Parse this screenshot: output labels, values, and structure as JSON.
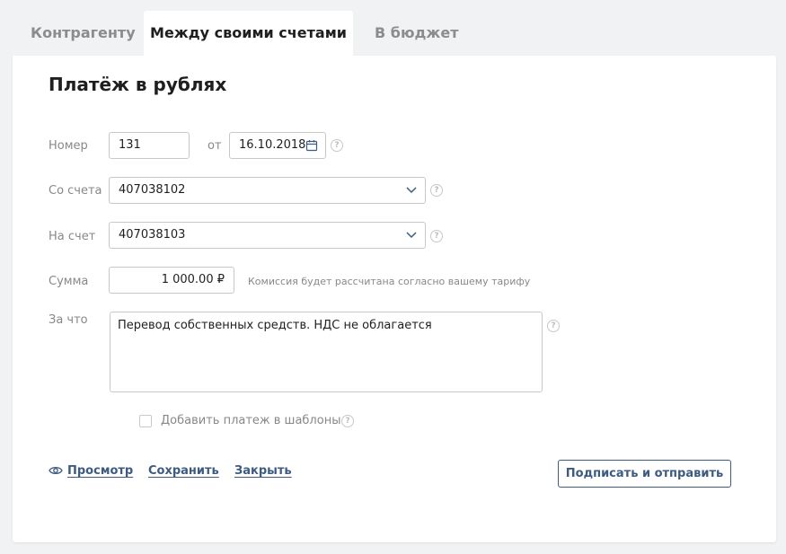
{
  "tabs": [
    {
      "label": "Контрагенту",
      "active": false
    },
    {
      "label": "Между своими счетами",
      "active": true
    },
    {
      "label": "В бюджет",
      "active": false
    }
  ],
  "form": {
    "title": "Платёж в рублях",
    "number_label": "Номер",
    "number_value": "131",
    "date_prefix": "от",
    "date_value": "16.10.2018",
    "from_label": "Со счета",
    "from_value": "407038102",
    "to_label": "На счет",
    "to_value": "407038103",
    "amount_label": "Сумма",
    "amount_value": "1 000.00 ₽",
    "commission_hint": "Комиссия будет рассчитана согласно вашему тарифу",
    "purpose_label": "За что",
    "purpose_value": "Перевод собственных средств. НДС не облагается",
    "template_checkbox_label": "Добавить платеж в шаблоны",
    "template_checked": false,
    "help_glyph": "?"
  },
  "actions": {
    "preview_label": "Просмотр",
    "save_label": "Сохранить",
    "close_label": "Закрыть",
    "submit_label": "Подписать и отправить"
  },
  "colors": {
    "background": "#f1f2f4",
    "card": "#ffffff",
    "link": "#3d5b80",
    "muted_text": "#888888",
    "border": "#c8c8c8"
  },
  "icons": [
    "calendar-icon",
    "chevron-down-icon",
    "help-icon",
    "eye-icon"
  ]
}
